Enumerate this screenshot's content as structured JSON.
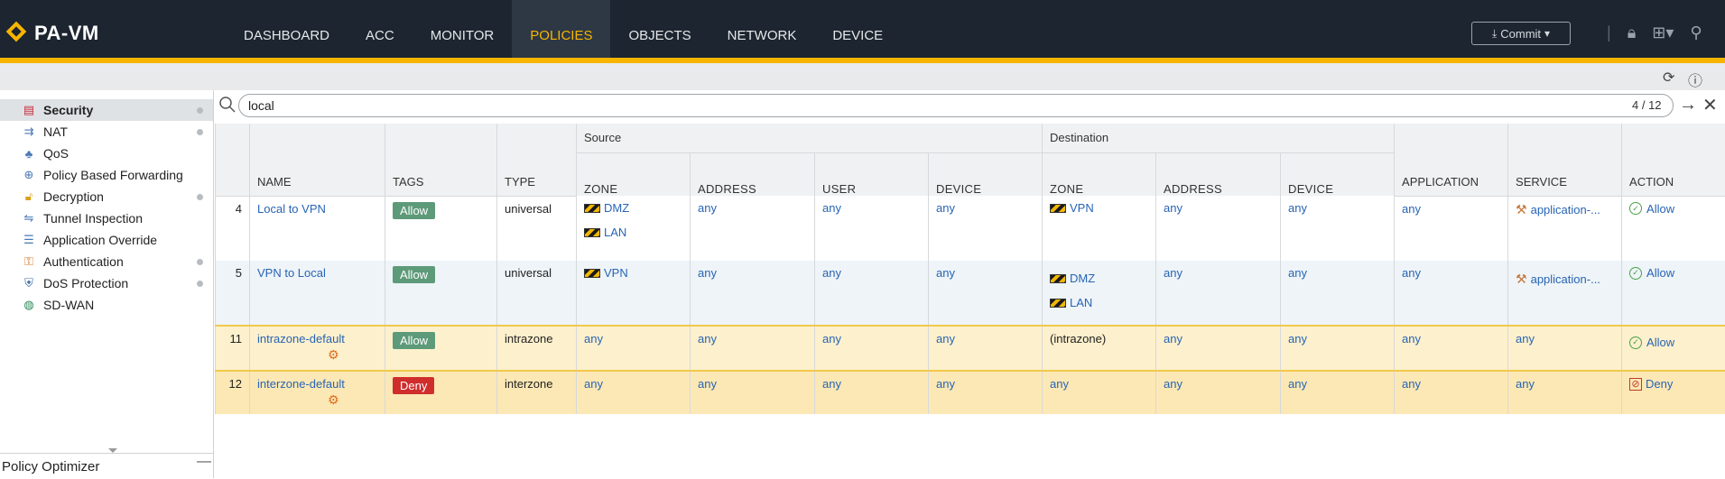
{
  "app": {
    "brand": "PA-VM"
  },
  "nav": {
    "tabs": [
      {
        "label": "DASHBOARD"
      },
      {
        "label": "ACC"
      },
      {
        "label": "MONITOR"
      },
      {
        "label": "POLICIES"
      },
      {
        "label": "OBJECTS"
      },
      {
        "label": "NETWORK"
      },
      {
        "label": "DEVICE"
      }
    ],
    "active": "POLICIES"
  },
  "header": {
    "commit_label": "Commit"
  },
  "sidebar": {
    "items": [
      {
        "label": "Security",
        "icon": "security-rules-icon",
        "active": true,
        "dot": true
      },
      {
        "label": "NAT",
        "icon": "nat-icon",
        "dot": true
      },
      {
        "label": "QoS",
        "icon": "qos-icon"
      },
      {
        "label": "Policy Based Forwarding",
        "icon": "pbf-icon"
      },
      {
        "label": "Decryption",
        "icon": "decryption-lock-icon",
        "dot": true
      },
      {
        "label": "Tunnel Inspection",
        "icon": "tunnel-inspection-icon"
      },
      {
        "label": "Application Override",
        "icon": "application-override-icon"
      },
      {
        "label": "Authentication",
        "icon": "authentication-icon",
        "dot": true
      },
      {
        "label": "DoS Protection",
        "icon": "dos-protection-icon",
        "dot": true
      },
      {
        "label": "SD-WAN",
        "icon": "sd-wan-icon"
      }
    ],
    "optimizer_label": "Policy Optimizer"
  },
  "filter": {
    "value": "local",
    "match_count": "4 / 12"
  },
  "table": {
    "group_headers": {
      "source": "Source",
      "destination": "Destination"
    },
    "columns": {
      "name": "NAME",
      "tags": "TAGS",
      "type": "TYPE",
      "src_zone": "ZONE",
      "src_address": "ADDRESS",
      "src_user": "USER",
      "src_device": "DEVICE",
      "dst_zone": "ZONE",
      "dst_address": "ADDRESS",
      "dst_device": "DEVICE",
      "application": "APPLICATION",
      "service": "SERVICE",
      "action": "ACTION"
    },
    "rows": [
      {
        "num": "4",
        "name": "Local to VPN",
        "tag": "Allow",
        "type": "universal",
        "src_zone": [
          "DMZ",
          "LAN"
        ],
        "src_address": "any",
        "src_user": "any",
        "src_device": "any",
        "dst_zone": [
          "VPN"
        ],
        "dst_address": "any",
        "dst_device": "any",
        "application": "any",
        "service": "application-...",
        "action": "Allow"
      },
      {
        "num": "5",
        "name": "VPN to Local",
        "tag": "Allow",
        "type": "universal",
        "src_zone": [
          "VPN"
        ],
        "src_address": "any",
        "src_user": "any",
        "src_device": "any",
        "dst_zone": [
          "DMZ",
          "LAN"
        ],
        "dst_address": "any",
        "dst_device": "any",
        "application": "any",
        "service": "application-...",
        "action": "Allow"
      },
      {
        "num": "11",
        "name": "intrazone-default",
        "tag": "Allow",
        "type": "intrazone",
        "src_zone": "any",
        "src_address": "any",
        "src_user": "any",
        "src_device": "any",
        "dst_zone": "(intrazone)",
        "dst_address": "any",
        "dst_device": "any",
        "application": "any",
        "service": "any",
        "action": "Allow"
      },
      {
        "num": "12",
        "name": "interzone-default",
        "tag": "Deny",
        "type": "interzone",
        "src_zone": "any",
        "src_address": "any",
        "src_user": "any",
        "src_device": "any",
        "dst_zone": "any",
        "dst_address": "any",
        "dst_device": "any",
        "application": "any",
        "service": "any",
        "action": "Deny"
      }
    ]
  },
  "colors": {
    "accent": "#f7b500",
    "topbar": "#1c2530",
    "allow": "#5d9a79",
    "deny": "#d02d2d",
    "link": "#2864b4"
  }
}
